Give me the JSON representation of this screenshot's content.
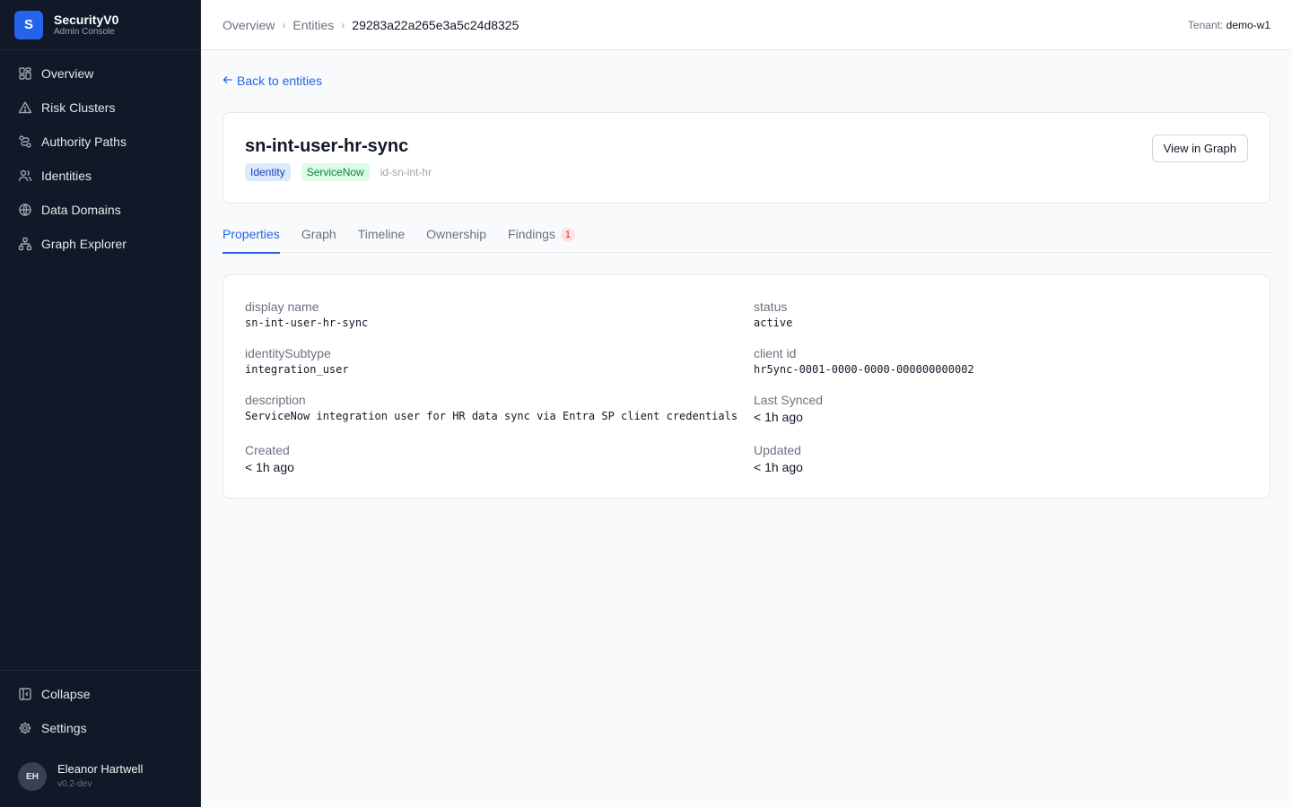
{
  "brand": {
    "logo": "S",
    "title": "SecurityV0",
    "subtitle": "Admin Console"
  },
  "sidebar": {
    "items": [
      {
        "label": "Overview",
        "icon": "grid-icon"
      },
      {
        "label": "Risk Clusters",
        "icon": "warning-triangle-icon"
      },
      {
        "label": "Authority Paths",
        "icon": "route-icon"
      },
      {
        "label": "Identities",
        "icon": "users-icon"
      },
      {
        "label": "Data Domains",
        "icon": "globe-icon"
      },
      {
        "label": "Graph Explorer",
        "icon": "network-icon"
      }
    ],
    "collapse_label": "Collapse",
    "settings_label": "Settings",
    "user": {
      "initials": "EH",
      "name": "Eleanor Hartwell",
      "version": "v0.2-dev"
    }
  },
  "topbar": {
    "breadcrumbs": [
      "Overview",
      "Entities",
      "29283a22a265e3a5c24d8325"
    ],
    "tenant_label": "Tenant:",
    "tenant_value": "demo-w1"
  },
  "page": {
    "back_label": "Back to entities",
    "entity": {
      "name": "sn-int-user-hr-sync",
      "type_badge": "Identity",
      "source_badge": "ServiceNow",
      "entity_id": "id-sn-int-hr",
      "view_graph_label": "View in Graph"
    },
    "tabs": [
      {
        "label": "Properties",
        "active": true
      },
      {
        "label": "Graph"
      },
      {
        "label": "Timeline"
      },
      {
        "label": "Ownership"
      },
      {
        "label": "Findings",
        "count": "1"
      }
    ],
    "properties": {
      "display_name": {
        "key": "display name",
        "value": "sn-int-user-hr-sync"
      },
      "status": {
        "key": "status",
        "value": "active"
      },
      "identity_subtype": {
        "key": "identitySubtype",
        "value": "integration_user"
      },
      "client_id": {
        "key": "client id",
        "value": "hr5ync-0001-0000-0000-000000000002"
      },
      "description": {
        "key": "description",
        "value": "ServiceNow integration user for HR data sync via Entra SP client credentials"
      },
      "last_synced": {
        "key": "Last Synced",
        "value": "< 1h ago"
      },
      "created": {
        "key": "Created",
        "value": "< 1h ago"
      },
      "updated": {
        "key": "Updated",
        "value": "< 1h ago"
      }
    }
  },
  "colors": {
    "sidebar_bg": "#111827",
    "accent": "#2563eb",
    "danger": "#dc2626"
  }
}
